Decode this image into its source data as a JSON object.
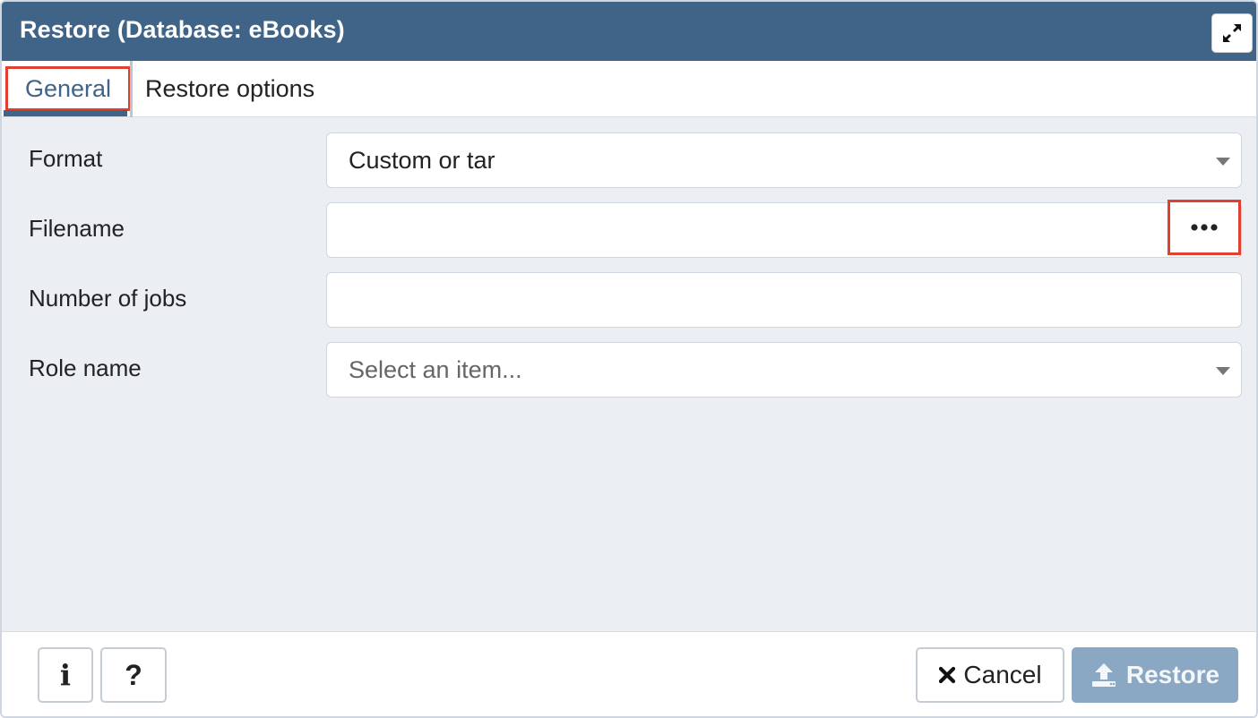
{
  "window": {
    "title": "Restore (Database: eBooks)",
    "maximize_icon": "expand-arrows-icon"
  },
  "tabs": [
    {
      "label": "General",
      "active": true
    },
    {
      "label": "Restore options",
      "active": false
    }
  ],
  "form": {
    "format": {
      "label": "Format",
      "value": "Custom or tar"
    },
    "filename": {
      "label": "Filename",
      "value": "",
      "browse_icon": "ellipsis-icon"
    },
    "jobs": {
      "label": "Number of jobs",
      "value": ""
    },
    "role": {
      "label": "Role name",
      "placeholder": "Select an item..."
    }
  },
  "footer": {
    "info_label": "i",
    "help_label": "?",
    "cancel_label": "Cancel",
    "restore_label": "Restore"
  },
  "colors": {
    "titlebar": "#3f6488",
    "highlight": "#e04030",
    "restore_button": "#8aa8c3"
  }
}
